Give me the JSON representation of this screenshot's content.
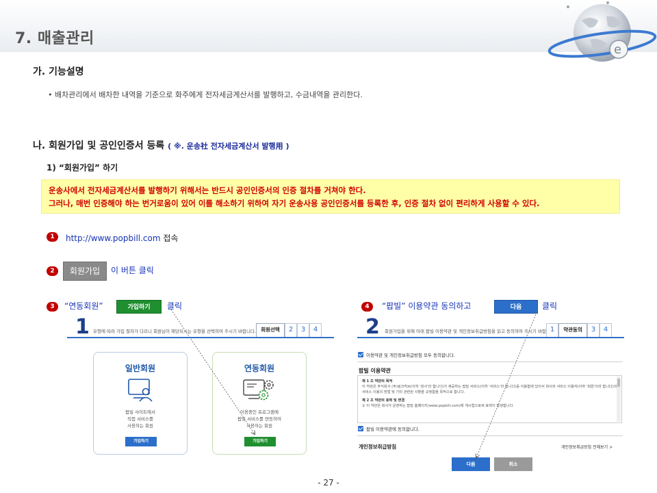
{
  "header": {
    "title": "7. 매출관리"
  },
  "section_a": {
    "heading": "가. 기능설명",
    "bullet": "• 배차관리에서 배차한 내역을 기준으로 화주에게 전자세금계산서를 발행하고, 수금내역을 관리한다."
  },
  "section_b": {
    "heading": "나. 회원가입 및 공인인증서 등록",
    "note": "( ※. 운송社 전자세금계산서 발행用 )",
    "sub": "1) “회원가입” 하기",
    "yellow_line1": "운송사에서 전자세금계산서를 발행하기 위해서는 반드시 공인인증서의 인증 절차를 거쳐야 한다.",
    "yellow_line2": "그러나, 매번 인증해야 하는 번거로움이 있어 이를 해소하기 위하여 자기 운송사용 공인인증서를 등록한 후, 인증 절차 없이 편리하게 사용할 수 있다."
  },
  "steps": {
    "s1_num": "1",
    "s1_url": "http://www.popbill.com",
    "s1_text": "접속",
    "s2_num": "2",
    "s2_button": "회원가입",
    "s2_text": "이 버튼 클릭",
    "s3_num": "3",
    "s3_text": "“연동회원”",
    "s3_button": "가입하기",
    "s3_click": "클릭",
    "s4_num": "4",
    "s4_text": "“팝빌”  이용약관 동의하고",
    "s4_button": "다음",
    "s4_click": "클릭"
  },
  "panel1": {
    "step": "1",
    "hint": "유형에 따라 가입 절차가 다르니 회원님이 해당되시는 유형을 선택하여 주시기 바랍니다.",
    "tabs": [
      "회원선택",
      "2",
      "3",
      "4"
    ],
    "card_general": {
      "title": "일반회원",
      "desc1": "팝빌 사이트에서",
      "desc2": "직접 서비스를",
      "desc3": "사용하는 회원",
      "button": "가입하기"
    },
    "card_linked": {
      "title": "연동회원",
      "desc1": "이용중인 프로그램에",
      "desc2": "팝빌 서비스를 연동하여",
      "desc3": "사용하는 회원",
      "button": "가입하기"
    }
  },
  "panel2": {
    "step": "2",
    "hint": "회원가입을 위해 아래 팝빌 이용약관 및 개인정보취급방침을 읽고 동의하여 주시기 바랍니다.",
    "tabs": [
      "1",
      "약관동의",
      "3",
      "4"
    ],
    "agree_all": "이용약관 및 개인정보취급방침 모두 동의합니다.",
    "terms_title": "팝빌 이용약관",
    "terms_l1": "제 1 조 약관의 목적",
    "terms_l2": "이 약관은 주식회사 (주)링크허브(이하 '회사'라 합니다)가 제공하는 팝빌 서비스(이하 '서비스'라 합니다)를 이용함에 있어서 회사와 서비스 이용자(이하 '회원'이라 합니다)의",
    "terms_l3": "서비스 이용의 방법 및 기타 관련된 사항을 규정함을 목적으로 합니다.",
    "terms_l4": "제 2 조 약관의 효력 및 변경",
    "terms_l5": "① 이 약관은 회사가 운영하는 팝빌 홈페이지(www.popbill.com)에 게시함으로써 효력이 발생합니다.",
    "agree_terms": "팝빌 이용약관에 동의합니다.",
    "privacy": "개인정보취급방침",
    "privacy_link": "개인정보취급방침 전체보기  >",
    "next": "다음",
    "cancel": "취소"
  },
  "footer": {
    "page": "- 27 -"
  },
  "colors": {
    "accent_red": "#c00000",
    "link_blue": "#1533b7",
    "green": "#1f8f2f",
    "blue": "#2c6fca",
    "yellow": "#ffffa8"
  }
}
